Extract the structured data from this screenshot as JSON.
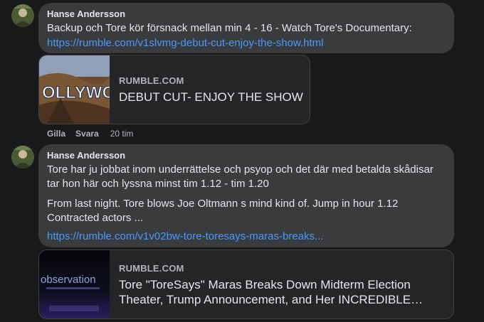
{
  "comments": [
    {
      "author": "Hanse Andersson",
      "text": "Backup och Tore kör försnack mellan min 4 - 16 - Watch Tore's Documentary:",
      "link": "https://rumble.com/v1slvmg-debut-cut-enjoy-the-show.html",
      "card": {
        "domain": "RUMBLE.COM",
        "title": "DEBUT CUT- ENJOY THE SHOW",
        "thumb_text": "OLLYWOO"
      },
      "actions": {
        "like": "Gilla",
        "reply": "Svara",
        "time": "20 tim"
      }
    },
    {
      "author": "Hanse Andersson",
      "text1": "Tore har ju jobbat inom underrättelse och psyop och det där med betalda skådisar tar hon här och lyssna minst tim 1.12 - tim 1.20",
      "text2": "From last night. Tore blows Joe Oltmann s mind kind of. Jump in hour 1.12 Contracted actors ...",
      "link": "https://rumble.com/v1v02bw-tore-toresays-maras-breaks...",
      "card": {
        "domain": "RUMBLE.COM",
        "title": "Tore \"ToreSays\" Maras Breaks Down Midterm Election Theater, Trump Announcement, and Her INCREDIBLE…",
        "thumb_text": "observation"
      }
    }
  ],
  "colors": {
    "background": "#18191a",
    "bubble": "#3a3b3c",
    "link": "#4599ff",
    "muted": "#b0b3b8"
  }
}
